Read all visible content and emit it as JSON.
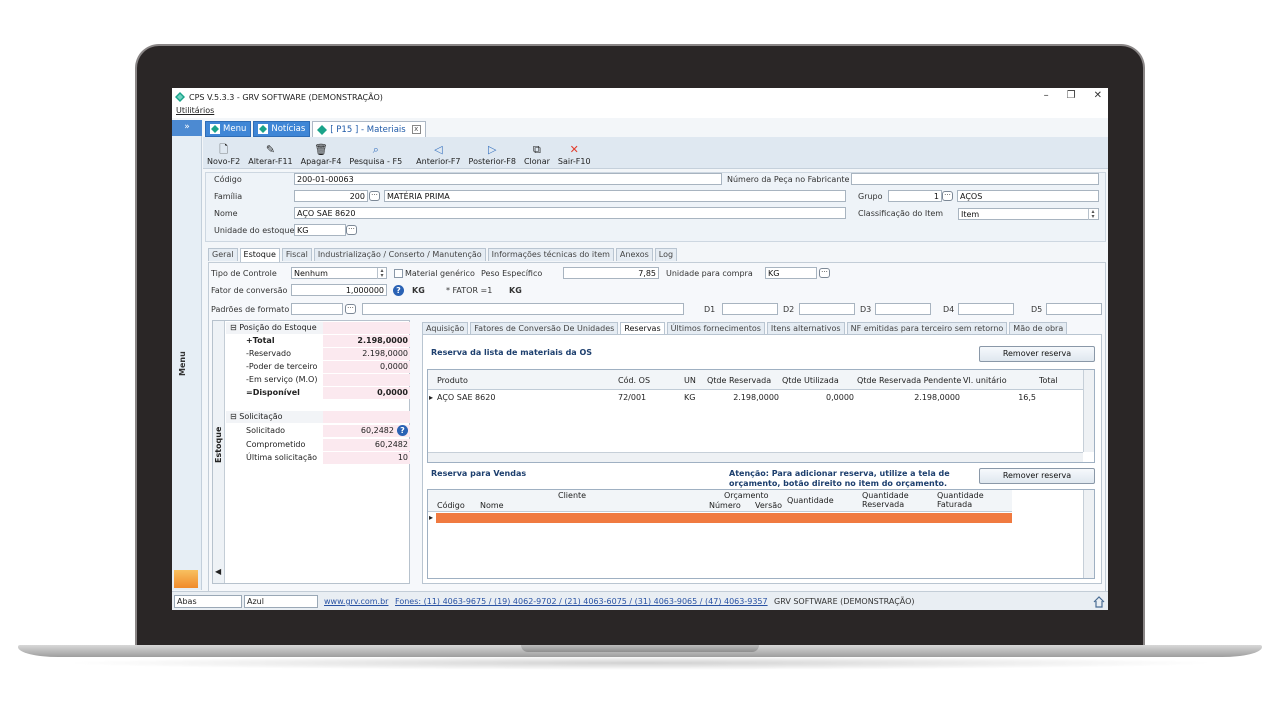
{
  "window": {
    "title": "CPS V.5.3.3 - GRV SOFTWARE (DEMONSTRAÇÃO)",
    "minimize": "–",
    "restore": "❐",
    "close": "✕"
  },
  "menubar": {
    "utilitarios": "Utilitários"
  },
  "sidebar": {
    "expand": "»",
    "label": "Menu"
  },
  "doc_tabs": [
    {
      "label": "Menu"
    },
    {
      "label": "Notícias"
    },
    {
      "label": "[ P15 ] - Materiais",
      "close": "x"
    }
  ],
  "toolbar": [
    {
      "label": "Novo-F2",
      "icon": "🗋"
    },
    {
      "label": "Alterar-F11",
      "icon": "✎"
    },
    {
      "label": "Apagar-F4",
      "icon": "🗑"
    },
    {
      "label": "Pesquisa - F5",
      "icon": "⌕"
    },
    {
      "label": "Anterior-F7",
      "icon": "◁"
    },
    {
      "label": "Posterior-F8",
      "icon": "▷"
    },
    {
      "label": "Clonar",
      "icon": "⧉"
    },
    {
      "label": "Sair-F10",
      "icon": "✕"
    }
  ],
  "form": {
    "codigo_label": "Código",
    "codigo": "200-01-00063",
    "num_fab_label": "Número da Peça no Fabricante",
    "num_fab": "",
    "familia_label": "Família",
    "familia_code": "200",
    "familia_name": "MATÉRIA PRIMA",
    "grupo_label": "Grupo",
    "grupo_code": "1",
    "grupo_name": "AÇOS",
    "nome_label": "Nome",
    "nome": "AÇO SAE  8620",
    "classif_label": "Classificação do Item",
    "classif": "Item",
    "unidade_label": "Unidade do estoque",
    "unidade": "KG",
    "dots": "···"
  },
  "sub_tabs": [
    {
      "label": "Geral"
    },
    {
      "label": "Estoque"
    },
    {
      "label": "Fiscal"
    },
    {
      "label": "Industrialização / Conserto / Manutenção"
    },
    {
      "label": "Informações técnicas do item"
    },
    {
      "label": "Anexos"
    },
    {
      "label": "Log"
    }
  ],
  "estoque": {
    "tipo_controle_label": "Tipo de Controle",
    "tipo_controle": "Nenhum",
    "material_generico_label": "Material genérico",
    "peso_label": "Peso Específico",
    "peso": "7,85",
    "unid_compra_label": "Unidade para compra",
    "unid_compra": "KG",
    "fator_label": "Fator de conversão",
    "fator": "1,000000",
    "fator_unit": "KG",
    "fator_note": "* FATOR =1",
    "fator_unit2": "KG",
    "padroes_label": "Padrões de formato",
    "d1": "D1",
    "d2": "D2",
    "d3": "D3",
    "d4": "D4",
    "d5": "D5"
  },
  "posicao": {
    "header": "Posição do Estoque",
    "rows": [
      {
        "name": "+Total",
        "value": "2.198,0000",
        "bold": true
      },
      {
        "name": "-Reservado",
        "value": "2.198,0000"
      },
      {
        "name": "-Poder de terceiro",
        "value": "0,0000"
      },
      {
        "name": "-Em serviço (M.O)",
        "value": ""
      },
      {
        "name": "=Disponível",
        "value": "0,0000",
        "bold": true
      }
    ],
    "sol_header": "Solicitação",
    "sol_rows": [
      {
        "name": "Solicitado",
        "value": "60,2482"
      },
      {
        "name": "Comprometido",
        "value": "60,2482"
      },
      {
        "name": "Última solicitação",
        "value": "10"
      }
    ],
    "side_label": "Estoque",
    "collapse": "⊟",
    "help": "?",
    "arrow": "◀"
  },
  "right_tabs": [
    {
      "label": "Aquisição"
    },
    {
      "label": "Fatores de Conversão De Unidades"
    },
    {
      "label": "Reservas"
    },
    {
      "label": "Últimos fornecimentos"
    },
    {
      "label": "Itens alternativos"
    },
    {
      "label": "NF emitidas para terceiro sem retorno"
    },
    {
      "label": "Mão de obra"
    }
  ],
  "reservas": {
    "title": "Reserva da lista de materiais da OS",
    "remove_btn": "Remover reserva",
    "columns": [
      "Produto",
      "Cód. OS",
      "UN",
      "Qtde Reservada",
      "Qtde Utilizada",
      "Qtde Reservada Pendente",
      "Vl. unitário",
      "Total"
    ],
    "rows": [
      {
        "produto": "AÇO SAE  8620",
        "cod_os": "72/001",
        "un": "KG",
        "qtde_res": "2.198,0000",
        "qtde_util": "0,0000",
        "qtde_pend": "2.198,0000",
        "vl_unit": "16,5",
        "total": ""
      }
    ],
    "row_marker": "▸"
  },
  "vendas": {
    "title": "Reserva para Vendas",
    "atencao_line1": "Atenção: Para adicionar reserva, utilize a tela de",
    "atencao_line2": "orçamento, botão direito no item do orçamento.",
    "remove_btn": "Remover reserva",
    "cliente": "Cliente",
    "codigo": "Código",
    "nome": "Nome",
    "orcamento": "Orçamento",
    "numero": "Número",
    "versao": "Versão",
    "quantidade": "Quantidade",
    "qtd_reservada_1": "Quantidade",
    "qtd_reservada_2": "Reservada",
    "qtd_faturada_1": "Quantidade",
    "qtd_faturada_2": "Faturada"
  },
  "status": {
    "abas": "Abas",
    "tema": "Azul",
    "site": "www.grv.com.br",
    "fones": "Fones: (11) 4063-9675 / (19) 4062-9702 / (21) 4063-6075 / (31) 4063-9065 / (47) 4063-9357",
    "empresa": "GRV SOFTWARE (DEMONSTRAÇÃO)"
  },
  "colors": {
    "accent": "#3f86d6",
    "orange_row": "#f07a40",
    "dark_title": "#1d3f6e"
  }
}
